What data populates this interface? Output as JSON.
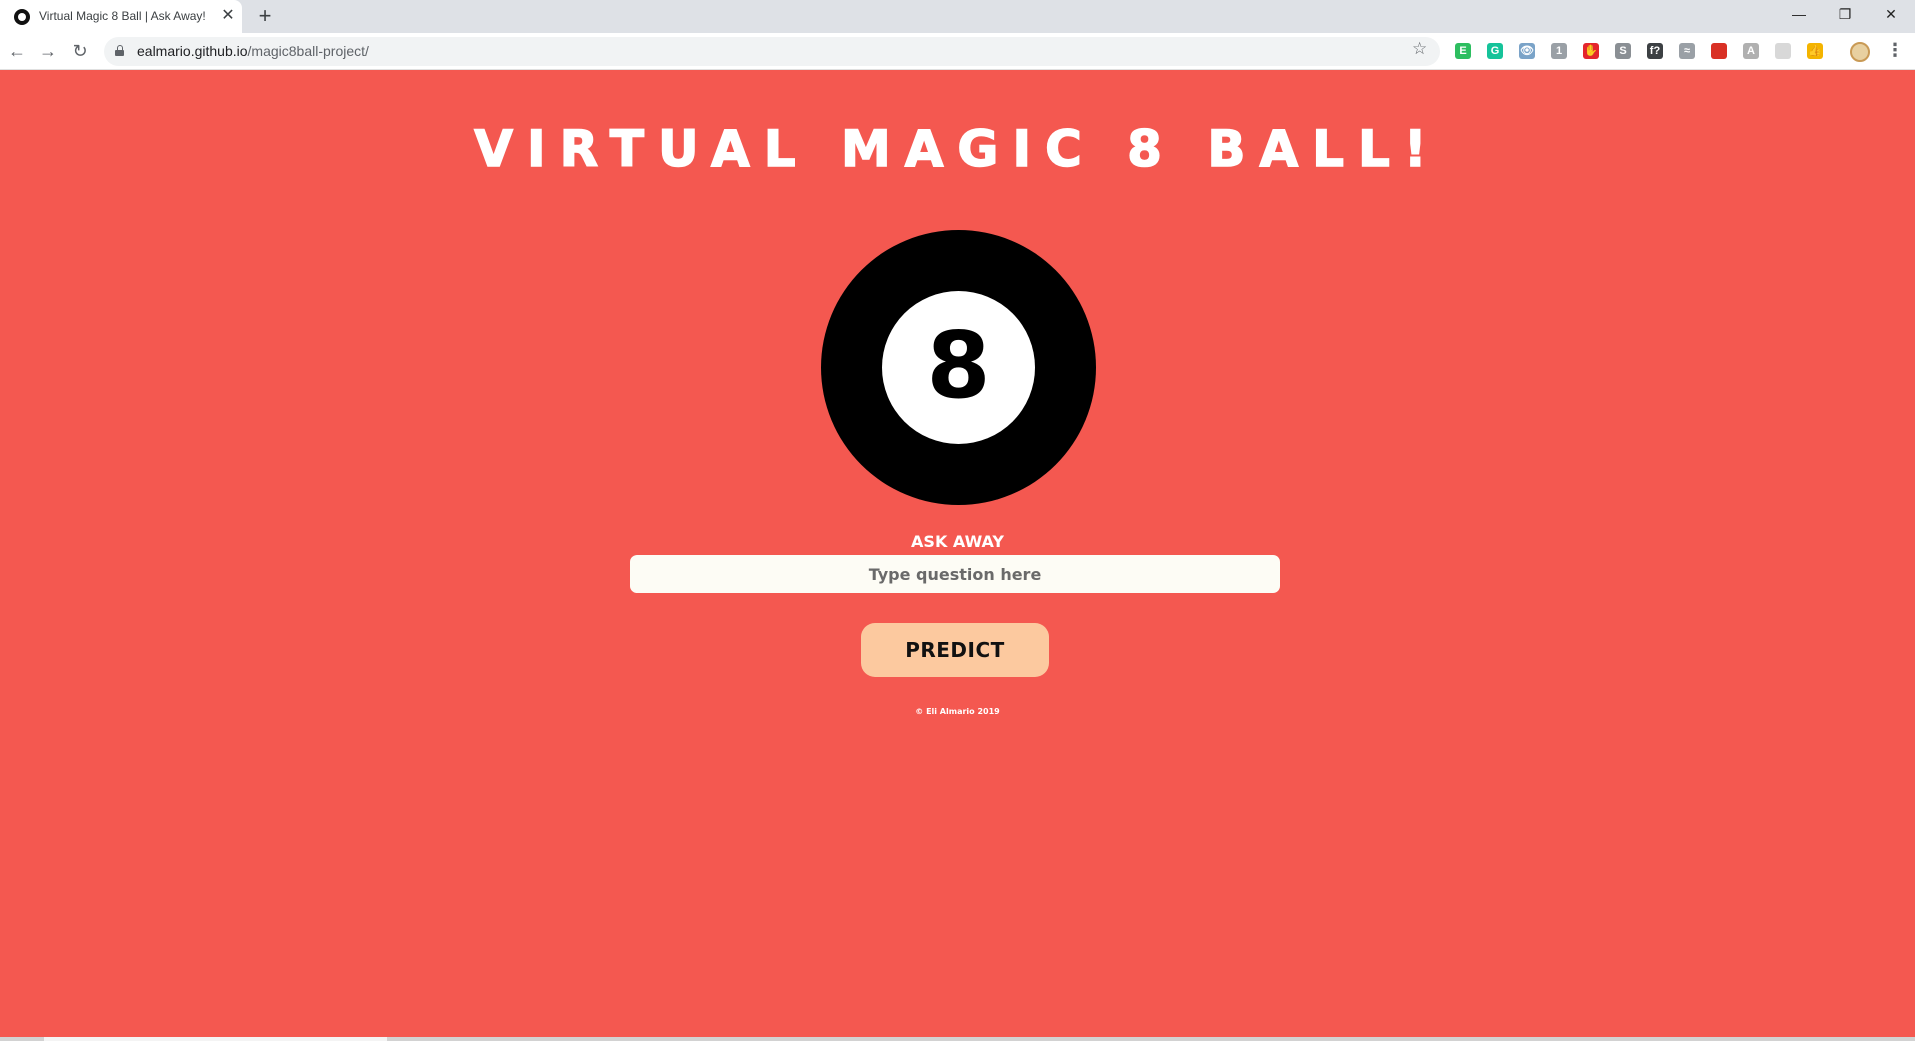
{
  "browser": {
    "tab_title": "Virtual Magic 8 Ball | Ask Away!",
    "tab_close": "✕",
    "new_tab": "+",
    "url_host": "ealmario.github.io",
    "url_path": "/magic8ball-project/",
    "window_controls": {
      "minimize": "—",
      "restore": "❐",
      "close": "✕"
    },
    "nav": {
      "back": "←",
      "forward": "→",
      "reload": "↻"
    },
    "star": "☆",
    "menu": "⋮",
    "extensions": [
      {
        "name": "evernote-extension-icon",
        "color": "#2dbe60",
        "glyph": "E"
      },
      {
        "name": "grammarly-extension-icon",
        "color": "#15c39a",
        "glyph": "G"
      },
      {
        "name": "eye-extension-icon",
        "color": "#7aa3c8",
        "glyph": "👁"
      },
      {
        "name": "security-extension-icon",
        "color": "#9aa0a6",
        "glyph": "1"
      },
      {
        "name": "adblock-extension-icon",
        "color": "#e4252d",
        "glyph": "✋"
      },
      {
        "name": "skype-extension-icon",
        "color": "#8a8f94",
        "glyph": "S"
      },
      {
        "name": "formula-extension-icon",
        "color": "#3c4043",
        "glyph": "f?"
      },
      {
        "name": "small-extension-icon",
        "color": "#9aa0a6",
        "glyph": "≈"
      },
      {
        "name": "red-square-extension-icon",
        "color": "#d93025",
        "glyph": ""
      },
      {
        "name": "pdf-extension-icon",
        "color": "#b0b0b0",
        "glyph": "A"
      },
      {
        "name": "grid-extension-icon",
        "color": "#d8d8d8",
        "glyph": ""
      },
      {
        "name": "thumbs-up-extension-icon",
        "color": "#f4b400",
        "glyph": "👍"
      }
    ]
  },
  "page": {
    "title": "VIRTUAL MAGIC 8 BALL!",
    "ball_number": "8",
    "ask_label": "ASK AWAY",
    "question_placeholder": "Type question here",
    "predict_label": "PREDICT",
    "footer": "© Eli Almario 2019"
  },
  "colors": {
    "background": "#f45850",
    "button": "#fcc99f",
    "ball": "#000000"
  }
}
